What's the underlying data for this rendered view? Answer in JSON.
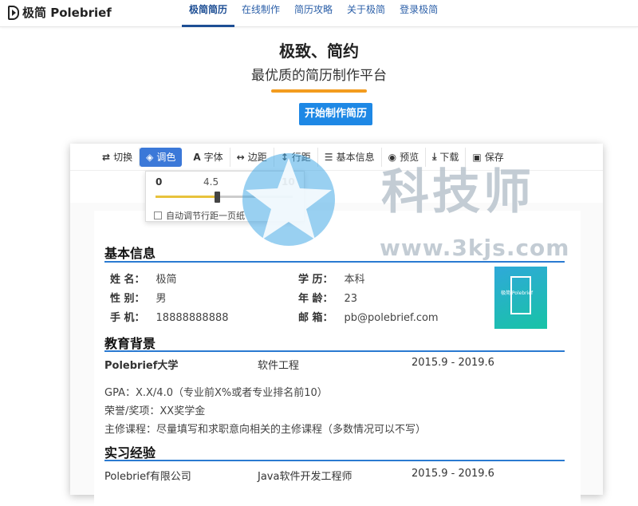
{
  "brand": {
    "name": "极简 Polebrief"
  },
  "nav": {
    "items": [
      {
        "label": "极简简历",
        "active": true
      },
      {
        "label": "在线制作"
      },
      {
        "label": "简历攻略"
      },
      {
        "label": "关于极简"
      },
      {
        "label": "登录极简"
      }
    ]
  },
  "hero": {
    "title": "极致、简约",
    "subtitle": "最优质的简历制作平台",
    "cta_label": "开始制作简历",
    "accent": "#f39c1f",
    "cta_color": "#1e88e5"
  },
  "toolbar": {
    "items": [
      {
        "icon": "swap-icon",
        "glyph": "⇄",
        "label": "切换"
      },
      {
        "icon": "paint-bucket-icon",
        "glyph": "◈",
        "label": "调色",
        "active": true
      },
      {
        "icon": "font-icon",
        "glyph": "A",
        "label": "字体"
      },
      {
        "icon": "margin-icon",
        "glyph": "↔",
        "label": "边距"
      },
      {
        "icon": "line-height-icon",
        "glyph": "↕",
        "label": "行距"
      },
      {
        "icon": "list-icon",
        "glyph": "☰",
        "label": "基本信息"
      },
      {
        "icon": "eye-icon",
        "glyph": "◉",
        "label": "预览"
      },
      {
        "icon": "download-icon",
        "glyph": "⤓",
        "label": "下载"
      },
      {
        "icon": "save-icon",
        "glyph": "▣",
        "label": "保存"
      }
    ]
  },
  "slider": {
    "min": "0",
    "value": "4.5",
    "max": "10",
    "value_fraction": 0.45,
    "auto_fit_label": "自动调节行距一页纸"
  },
  "resume": {
    "basic": {
      "title": "基本信息",
      "fields": [
        {
          "key": "姓 名：",
          "value": "极简"
        },
        {
          "key": "学 历：",
          "value": "本科"
        },
        {
          "key": "性 别：",
          "value": "男"
        },
        {
          "key": "年 龄：",
          "value": "23"
        },
        {
          "key": "手 机：",
          "value": "18888888888"
        },
        {
          "key": "邮 箱：",
          "value": "pb@polebrief.com"
        }
      ],
      "photo_text": "极简 Polebrief"
    },
    "education": {
      "title": "教育背景",
      "school": "Polebrief大学",
      "major": "软件工程",
      "period": "2015.9 - 2019.6",
      "details": [
        "GPA：X.X/4.0（专业前X%或者专业排名前10）",
        "荣誉/奖项：XX奖学金",
        "主修课程：尽量填写和求职意向相关的主修课程（多数情况可以不写）"
      ]
    },
    "internship": {
      "title": "实习经验",
      "company": "Polebrief有限公司",
      "role": "Java软件开发工程师",
      "period": "2015.9 - 2019.6"
    }
  },
  "watermark": {
    "text": "科技师",
    "url": "www.3kjs.com"
  }
}
